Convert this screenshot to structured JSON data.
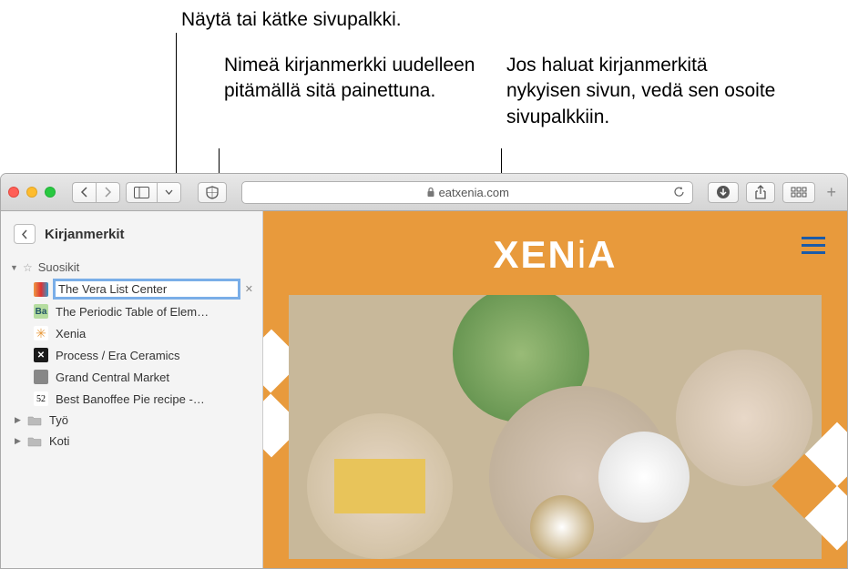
{
  "callouts": {
    "sidebar_toggle": "Näytä tai kätke sivupalkki.",
    "rename": "Nimeä kirjanmerkki uudelleen pitämällä sitä painettuna.",
    "drag": "Jos haluat kirjanmerkitä nykyisen sivun, vedä sen osoite sivupalkkiin."
  },
  "toolbar": {
    "url": "eatxenia.com"
  },
  "sidebar": {
    "title": "Kirjanmerkit",
    "favorites_label": "Suosikit",
    "items": [
      "The Vera List Center",
      "The Periodic Table of Elem…",
      "Xenia",
      "Process / Era Ceramics",
      "Grand Central Market",
      "Best Banoffee Pie recipe -…"
    ],
    "folders": [
      "Työ",
      "Koti"
    ]
  },
  "page": {
    "logo_main": "XEN",
    "logo_thin": "i",
    "logo_end": "A"
  }
}
